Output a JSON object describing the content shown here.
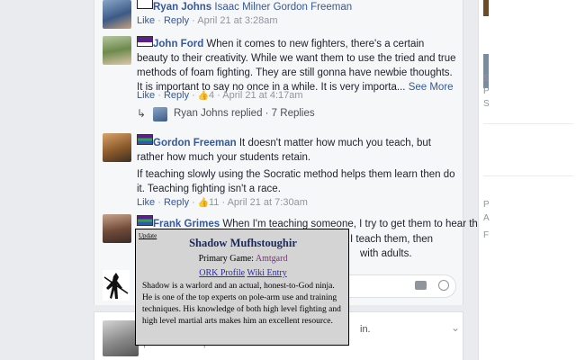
{
  "comments": [
    {
      "author": "Ryan Johns",
      "text": "Isaac Milner Gordon Freeman",
      "like_label": "Like",
      "reply_label": "Reply",
      "likes": "",
      "time": "April 21 at 3:28am"
    },
    {
      "author": "John Ford",
      "text": "When it comes to new fighters, there's a certain beauty to their creativity. While we want them to use the tried and true methods of foam fighting. They are still gonna have newbie thoughts. It is important to say no once in a while. It is very importa...",
      "see_more": "See More",
      "like_label": "Like",
      "reply_label": "Reply",
      "likes": "4",
      "time": "April 21 at 4:17am"
    },
    {
      "author": "Gordon Freeman",
      "text": "It doesn't matter how much you teach, but rather how much your students retain.",
      "text2": "If teaching slowly using the Socratic method helps them learn then do it. Teaching fighting isn't a race.",
      "like_label": "Like",
      "reply_label": "Reply",
      "likes": "11",
      "time": "April 21 at 7:30am"
    },
    {
      "author": "Frank Grimes",
      "text": "When I'm teaching someone, I try to get them to hear the",
      "text_tail1": "I teach them, then",
      "text_tail2": "with adults."
    }
  ],
  "replies_summary": {
    "author": "Ryan Johns",
    "text": "replied · 7 Replies"
  },
  "separator": "·",
  "tooltip": {
    "update_label": "Update",
    "name": "Shadow Mufhstoughir",
    "game_label": "Primary Game:",
    "game_value": "Amtgard",
    "profile_link": "ORK Profile",
    "wiki_link": "Wiki Entry",
    "bio": "Shadow is a warlord and an actual, honest-to-God ninja. He is one of the top experts on pole-arm use and training techniques. His knowledge of both high level fighting and high level martial arts makes him an excellent resource."
  },
  "next_post": {
    "partial_text": "in.",
    "time_partial": "April 21 at 6:07pm"
  },
  "right_panel": {
    "letters": [
      "S",
      "P",
      "S",
      "P",
      "A",
      "F"
    ]
  },
  "icons": {
    "camera": "camera-icon",
    "smiley": "smiley-icon",
    "thumb": "thumbs-up-icon",
    "reply_arrow": "reply-arrow-icon"
  },
  "colors": {
    "link": "#365899",
    "meta": "#90949c",
    "tooltip_bg": "#d4d4d4",
    "like_blue": "#598dfe"
  }
}
